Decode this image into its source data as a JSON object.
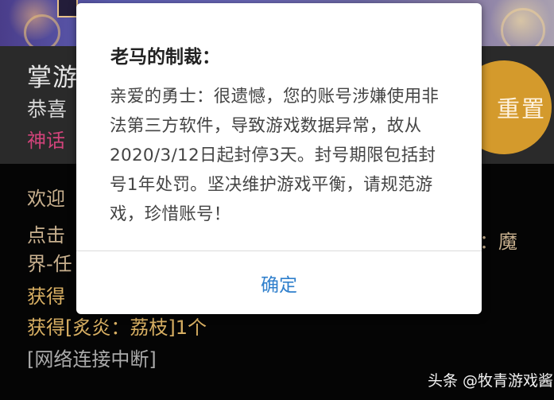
{
  "background": {
    "title_partial": "掌游",
    "subtitle_partial": "恭喜",
    "myth_partial": "神话",
    "reset_button": "重置",
    "log_lines": [
      "欢迎",
      "点击",
      "界-任",
      "获得",
      "获得[炙炎：荔枝]1个",
      "[网络连接中断]"
    ],
    "log_right_fragment": "：魔"
  },
  "dialog": {
    "title": "老马的制裁：",
    "message": "亲爱的勇士：很遗憾，您的账号涉嫌使用非法第三方软件，导致游戏数据异常，故从2020/3/12日起封停3天。封号期限包括封号1年处罚。坚决维护游戏平衡，请规范游戏，珍惜账号！",
    "confirm_label": "确定"
  },
  "watermark": "头条 @牧青游戏酱",
  "colors": {
    "accent_blue": "#2f7fcc",
    "reset_orange": "#d49a2c",
    "myth_pink": "#d1437a",
    "log_gold": "#d9b063"
  }
}
